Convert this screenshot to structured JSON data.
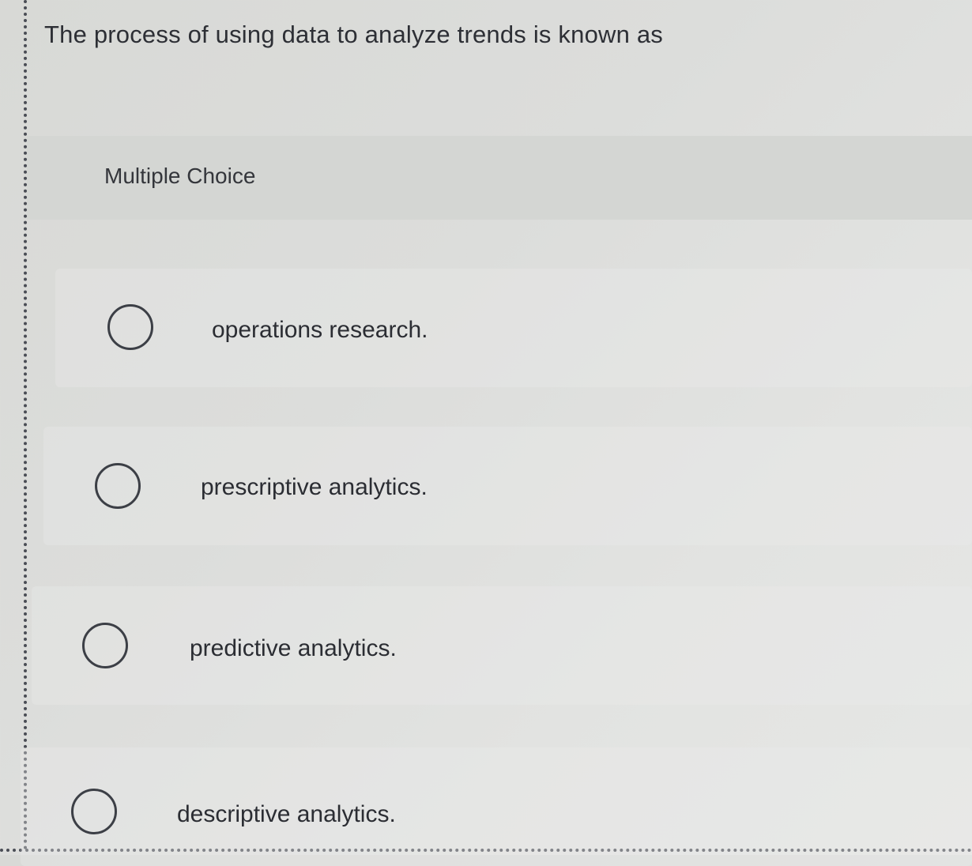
{
  "question": {
    "text": "The process of using data to analyze trends is known as"
  },
  "question_type": {
    "label": "Multiple Choice"
  },
  "options": [
    {
      "label": "operations research.",
      "selected": false
    },
    {
      "label": "prescriptive analytics.",
      "selected": false
    },
    {
      "label": "predictive analytics.",
      "selected": false
    },
    {
      "label": "descriptive analytics.",
      "selected": false
    }
  ]
}
